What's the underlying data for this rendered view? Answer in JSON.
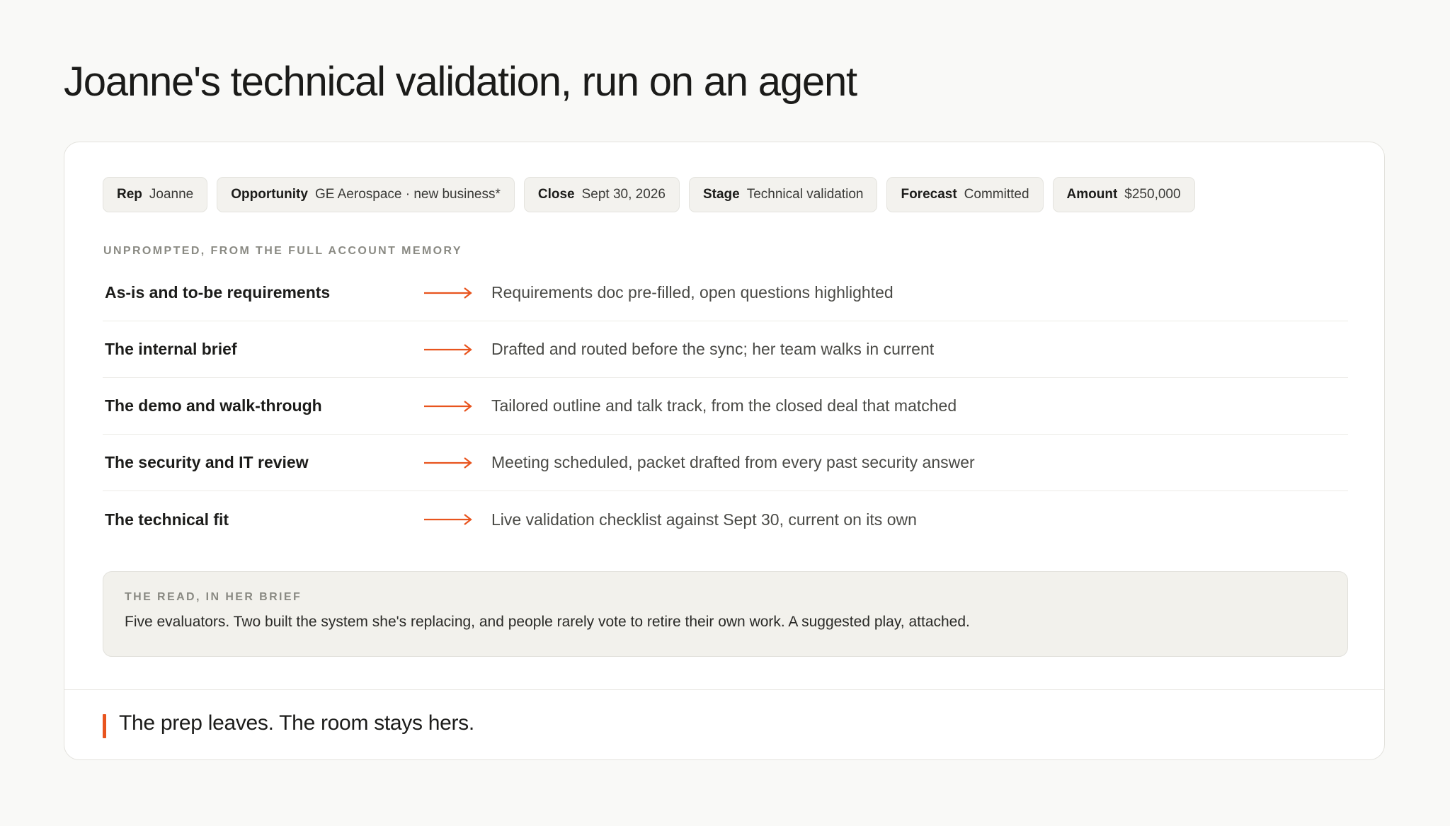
{
  "title": "Joanne's technical validation, run on an agent",
  "chips": [
    {
      "label": "Rep",
      "value": "Joanne"
    },
    {
      "label": "Opportunity",
      "value": "GE Aerospace · new business*"
    },
    {
      "label": "Close",
      "value": "Sept 30, 2026"
    },
    {
      "label": "Stage",
      "value": "Technical validation"
    },
    {
      "label": "Forecast",
      "value": "Committed"
    },
    {
      "label": "Amount",
      "value": "$250,000"
    }
  ],
  "section_label": "UNPROMPTED, FROM THE FULL ACCOUNT MEMORY",
  "rows": [
    {
      "label": "As-is and to-be requirements",
      "value": "Requirements doc pre-filled, open questions highlighted"
    },
    {
      "label": "The internal brief",
      "value": "Drafted and routed before the sync; her team walks in current"
    },
    {
      "label": "The demo and walk-through",
      "value": "Tailored outline and talk track, from the closed deal that matched"
    },
    {
      "label": "The security and IT review",
      "value": "Meeting scheduled, packet drafted from every past security answer"
    },
    {
      "label": "The technical fit",
      "value": "Live validation checklist against Sept 30, current on its own"
    }
  ],
  "note": {
    "label": "THE READ, IN HER BRIEF",
    "text": "Five evaluators. Two built the system she's replacing, and people rarely vote to retire their own work. A suggested play, attached."
  },
  "footer": {
    "text": "The prep leaves. The room stays hers."
  },
  "colors": {
    "accent": "#e8541e",
    "background": "#f9f9f7",
    "card": "#ffffff",
    "chip_bg": "#f3f2ee",
    "note_bg": "#f2f1ec"
  },
  "icons": {
    "row_arrow": "arrow-right-icon"
  }
}
